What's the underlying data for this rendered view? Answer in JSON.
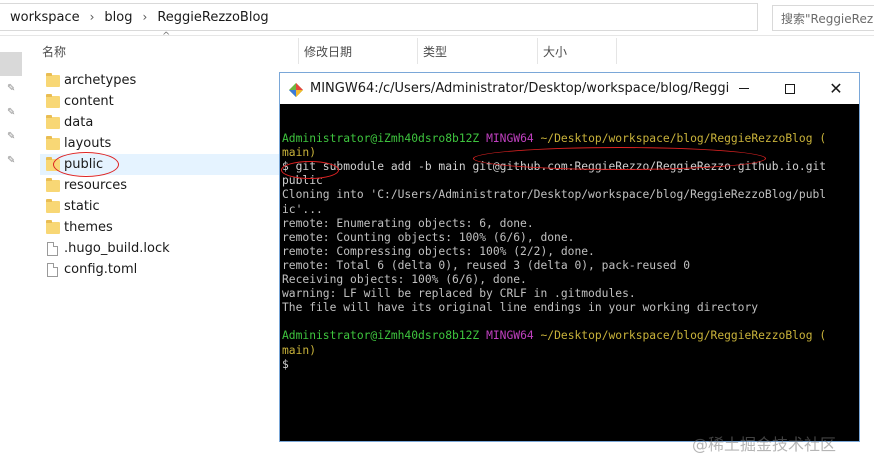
{
  "explorer": {
    "breadcrumbs": [
      "workspace",
      "blog",
      "ReggieRezzoBlog"
    ],
    "search_placeholder": "搜索\"ReggieRez",
    "columns": {
      "name": "名称",
      "modified": "修改日期",
      "type": "类型",
      "size": "大小"
    },
    "items": [
      {
        "name": "archetypes",
        "icon": "folder-icon"
      },
      {
        "name": "content",
        "icon": "folder-icon"
      },
      {
        "name": "data",
        "icon": "folder-icon"
      },
      {
        "name": "layouts",
        "icon": "folder-icon"
      },
      {
        "name": "public",
        "icon": "folder-icon",
        "selected": true
      },
      {
        "name": "resources",
        "icon": "folder-icon"
      },
      {
        "name": "static",
        "icon": "folder-icon"
      },
      {
        "name": "themes",
        "icon": "folder-icon"
      },
      {
        "name": ".hugo_build.lock",
        "icon": "file-icon"
      },
      {
        "name": "config.toml",
        "icon": "file-icon"
      }
    ]
  },
  "terminal": {
    "title": "MINGW64:/c/Users/Administrator/Desktop/workspace/blog/Reggie...",
    "prompt1": {
      "user": "Administrator@iZmh40dsro8b12Z",
      "env": "MINGW64",
      "path": "~/Desktop/workspace/blog/ReggieRezzoBlog",
      "branch_open": "(",
      "branch": "main)"
    },
    "command": {
      "pre": "$ git submodule add -b main ",
      "repo": "git@github.com:ReggieRezzo/ReggieRezzo.github.io.git",
      "target": "public"
    },
    "output": [
      "Cloning into 'C:/Users/Administrator/Desktop/workspace/blog/ReggieRezzoBlog/publ",
      "ic'...",
      "remote: Enumerating objects: 6, done.",
      "remote: Counting objects: 100% (6/6), done.",
      "remote: Compressing objects: 100% (2/2), done.",
      "remote: Total 6 (delta 0), reused 3 (delta 0), pack-reused 0",
      "Receiving objects: 100% (6/6), done.",
      "warning: LF will be replaced by CRLF in .gitmodules.",
      "The file will have its original line endings in your working directory"
    ],
    "prompt2": {
      "user": "Administrator@iZmh40dsro8b12Z",
      "env": "MINGW64",
      "path": "~/Desktop/workspace/blog/ReggieRezzoBlog",
      "branch_open": "(",
      "branch": "main)"
    },
    "final_prompt": "$"
  },
  "watermark": "@稀土掘金技术社区",
  "colors": {
    "prompt_green": "#3ec43e",
    "env_magenta": "#c040c0",
    "path_yellow": "#c8b23a",
    "annotation_red": "#dd2222",
    "selection_blue": "#e5f3ff"
  }
}
